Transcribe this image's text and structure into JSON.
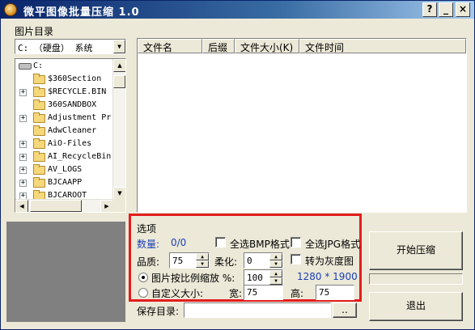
{
  "window": {
    "title": "微平图像批量压缩 1.0",
    "buttons": {
      "help": "?",
      "minimize": "_",
      "close": "×"
    }
  },
  "left_panel": {
    "group_label": "图片目录",
    "drive_combo_value": "C: （硬盘） 系统",
    "tree": {
      "root": "C:",
      "items": [
        {
          "label": "$360Section",
          "expandable": false
        },
        {
          "label": "$RECYCLE.BIN",
          "expandable": true
        },
        {
          "label": "360SANDBOX",
          "expandable": false
        },
        {
          "label": "Adjustment Pr",
          "expandable": true
        },
        {
          "label": "AdwCleaner",
          "expandable": false
        },
        {
          "label": "AiO-Files",
          "expandable": true
        },
        {
          "label": "AI_RecycleBin",
          "expandable": true
        },
        {
          "label": "AV_LOGS",
          "expandable": true
        },
        {
          "label": "BJCAAPP",
          "expandable": true
        },
        {
          "label": "BJCAROOT",
          "expandable": true
        }
      ]
    }
  },
  "file_list": {
    "columns": [
      "文件名",
      "后缀",
      "文件大小(K)",
      "文件时间"
    ]
  },
  "options": {
    "group_label": "选项",
    "count_label": "数量:",
    "count_value": "0/0",
    "select_all_bmp": "全选BMP格式",
    "select_all_jpg": "全选JPG格式",
    "quality_label": "品质:",
    "quality_value": "75",
    "soften_label": "柔化:",
    "soften_value": "0",
    "grayscale_label": "转为灰度图",
    "scale_label": "图片按比例缩放 %:",
    "scale_value": "100",
    "resolution_info": "1280 * 1900",
    "custom_size_label": "自定义大小:",
    "width_label": "宽:",
    "width_value": "75",
    "height_label": "高:",
    "height_value": "75",
    "selected_mode": "scale"
  },
  "save": {
    "label": "保存目录:",
    "path_value": "",
    "browse_label": ".."
  },
  "actions": {
    "start_label": "开始压缩",
    "exit_label": "退出",
    "progress": 0
  }
}
